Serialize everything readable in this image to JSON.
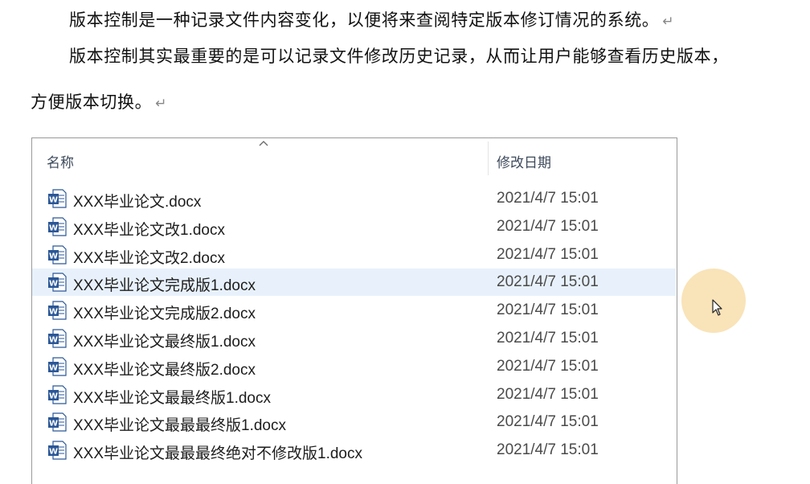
{
  "document": {
    "paragraphs": [
      "版本控制是一种记录文件内容变化，以便将来查阅特定版本修订情况的系统。",
      "版本控制其实最重要的是可以记录文件修改历史记录，从而让用户能够查看历史版本，",
      "方便版本切换。"
    ],
    "paragraph_mark": "↵"
  },
  "explorer": {
    "columns": {
      "name": "名称",
      "date": "修改日期"
    },
    "sort_indicator": "ascending",
    "file_icon": "word-document-icon",
    "files": [
      {
        "name": "XXX毕业论文.docx",
        "date": "2021/4/7 15:01"
      },
      {
        "name": "XXX毕业论文改1.docx",
        "date": "2021/4/7 15:01"
      },
      {
        "name": "XXX毕业论文改2.docx",
        "date": "2021/4/7 15:01"
      },
      {
        "name": "XXX毕业论文完成版1.docx",
        "date": "2021/4/7 15:01",
        "selected": true
      },
      {
        "name": "XXX毕业论文完成版2.docx",
        "date": "2021/4/7 15:01"
      },
      {
        "name": "XXX毕业论文最终版1.docx",
        "date": "2021/4/7 15:01"
      },
      {
        "name": "XXX毕业论文最终版2.docx",
        "date": "2021/4/7 15:01"
      },
      {
        "name": "XXX毕业论文最最终版1.docx",
        "date": "2021/4/7 15:01"
      },
      {
        "name": "XXX毕业论文最最最终版1.docx",
        "date": "2021/4/7 15:01"
      },
      {
        "name": "XXX毕业论文最最最终绝对不修改版1.docx",
        "date": "2021/4/7 15:01"
      }
    ]
  },
  "colors": {
    "selected_row": "#e8f1fb",
    "word_blue": "#2b5797",
    "cursor_highlight": "#f9e2b4"
  }
}
